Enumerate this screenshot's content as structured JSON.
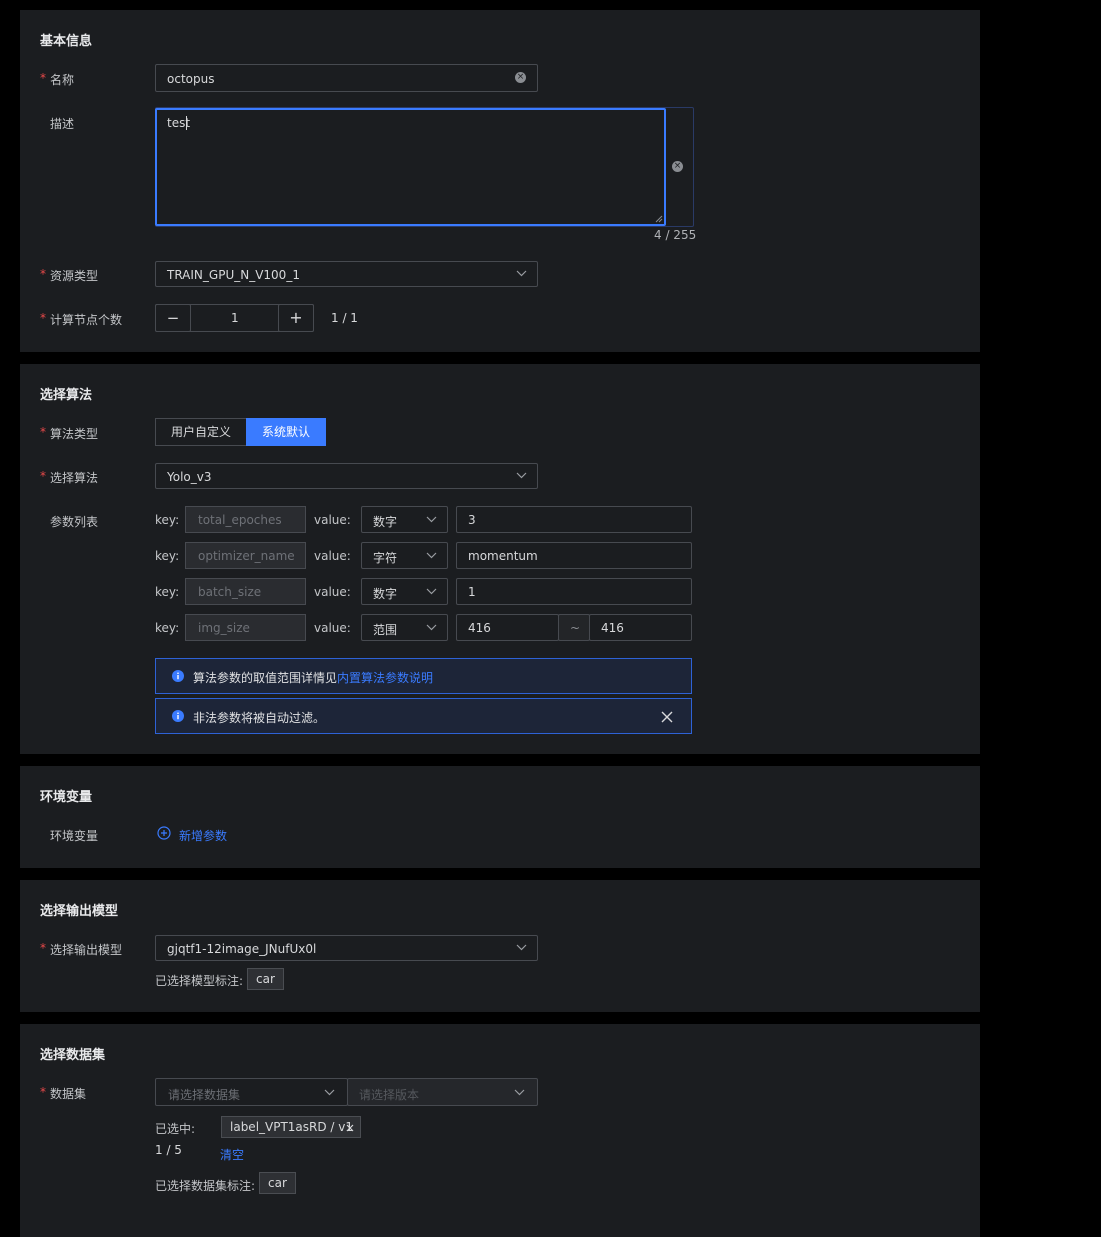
{
  "basic": {
    "title": "基本信息",
    "name_label": "名称",
    "name_value": "octopus",
    "desc_label": "描述",
    "desc_value": "test",
    "desc_count": "4 / 255",
    "resource_label": "资源类型",
    "resource_value": "TRAIN_GPU_N_V100_1",
    "nodes_label": "计算节点个数",
    "nodes_value": "1",
    "nodes_count": "1 / 1",
    "minus": "−",
    "plus": "+"
  },
  "algo": {
    "title": "选择算法",
    "type_label": "算法类型",
    "type_options": [
      "用户自定义",
      "系统默认"
    ],
    "select_label": "选择算法",
    "select_value": "Yolo_v3",
    "params_label": "参数列表",
    "key_prefix": "key:",
    "value_prefix": "value:",
    "params": [
      {
        "key": "total_epoches",
        "type": "数字",
        "value": "3"
      },
      {
        "key": "optimizer_name",
        "type": "字符",
        "value": "momentum"
      },
      {
        "key": "batch_size",
        "type": "数字",
        "value": "1"
      },
      {
        "key": "img_size",
        "type": "范围",
        "value": "416",
        "value2": "416",
        "sep": "~"
      }
    ],
    "alert1_text": "算法参数的取值范围详情见",
    "alert1_link": "内置算法参数说明",
    "alert2_text": "非法参数将被自动过滤。"
  },
  "env": {
    "title": "环境变量",
    "label": "环境变量",
    "add_label": "新增参数"
  },
  "output": {
    "title": "选择输出模型",
    "label": "选择输出模型",
    "value": "gjqtf1-12image_JNufUx0l",
    "tags_label": "已选择模型标注:",
    "tag": "car"
  },
  "dataset": {
    "title": "选择数据集",
    "label": "数据集",
    "placeholder_dataset": "请选择数据集",
    "placeholder_version": "请选择版本",
    "selected_label": "已选中:",
    "selected_item": "label_VPT1asRD / v1",
    "count": "1 / 5",
    "clear_label": "清空",
    "tags_label": "已选择数据集标注:",
    "tag": "car"
  },
  "colors": {
    "accent": "#3a7bff",
    "required": "#e84a4a",
    "panel": "#1b1d20"
  }
}
